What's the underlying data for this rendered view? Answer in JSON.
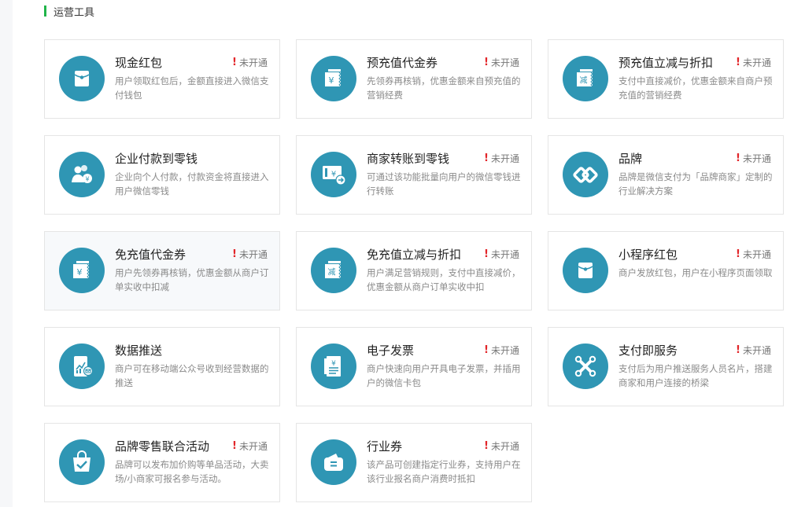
{
  "section": {
    "title": "运营工具"
  },
  "colors": {
    "accent": "#21b44a",
    "icon_bg": "#2f96b4",
    "warning": "#e2262a"
  },
  "cards": [
    {
      "name": "现金红包",
      "icon": "red-packet-icon",
      "status": "未开通",
      "desc": "用户领取红包后，金额直接进入微信支付钱包"
    },
    {
      "name": "预充值代金券",
      "icon": "yuan-coupon-icon",
      "status": "未开通",
      "desc": "先领券再核销，优惠金额来自预充值的营销经费"
    },
    {
      "name": "预充值立减与折扣",
      "icon": "discount-coupon-icon",
      "icon_text": "减",
      "status": "未开通",
      "desc": "支付中直接减价，优惠金额来自商户预充值的营销经费"
    },
    {
      "name": "企业付款到零钱",
      "icon": "people-money-icon",
      "status": "",
      "desc": "企业向个人付款，付款资金将直接进入用户微信零钱"
    },
    {
      "name": "商家转账到零钱",
      "icon": "transfer-icon",
      "status": "未开通",
      "desc": "可通过该功能批量向用户的微信零钱进行转账"
    },
    {
      "name": "品牌",
      "icon": "brand-link-icon",
      "status": "未开通",
      "desc": "品牌是微信支付为「品牌商家」定制的行业解决方案"
    },
    {
      "name": "免充值代金券",
      "icon": "yuan-coupon-icon",
      "status": "未开通",
      "desc": "用户先领券再核销，优惠金额从商户订单实收中扣减"
    },
    {
      "name": "免充值立减与折扣",
      "icon": "discount-coupon-icon",
      "icon_text": "减",
      "status": "未开通",
      "desc": "用户满足营销规则，支付中直接减价，优惠金额从商户订单实收中扣"
    },
    {
      "name": "小程序红包",
      "icon": "red-packet-icon",
      "status": "未开通",
      "desc": "商户发放红包，用户在小程序页面领取"
    },
    {
      "name": "数据推送",
      "icon": "data-push-icon",
      "status": "",
      "desc": "商户可在移动端公众号收到经营数据的推送"
    },
    {
      "name": "电子发票",
      "icon": "invoice-icon",
      "status": "未开通",
      "desc": "商户快速向用户开具电子发票，并插用户的微信卡包"
    },
    {
      "name": "支付即服务",
      "icon": "service-link-icon",
      "status": "未开通",
      "desc": "支付后为用户推送服务人员名片，搭建商家和用户连接的桥梁"
    },
    {
      "name": "品牌零售联合活动",
      "icon": "shopping-bag-icon",
      "status": "未开通",
      "desc": "品牌可以发布加价购等单品活动，大卖场/小商家可报名参与活动。"
    },
    {
      "name": "行业券",
      "icon": "wallet-icon",
      "status": "未开通",
      "desc": "该产品可创建指定行业券，支持用户在该行业报名商户消费时抵扣"
    }
  ]
}
